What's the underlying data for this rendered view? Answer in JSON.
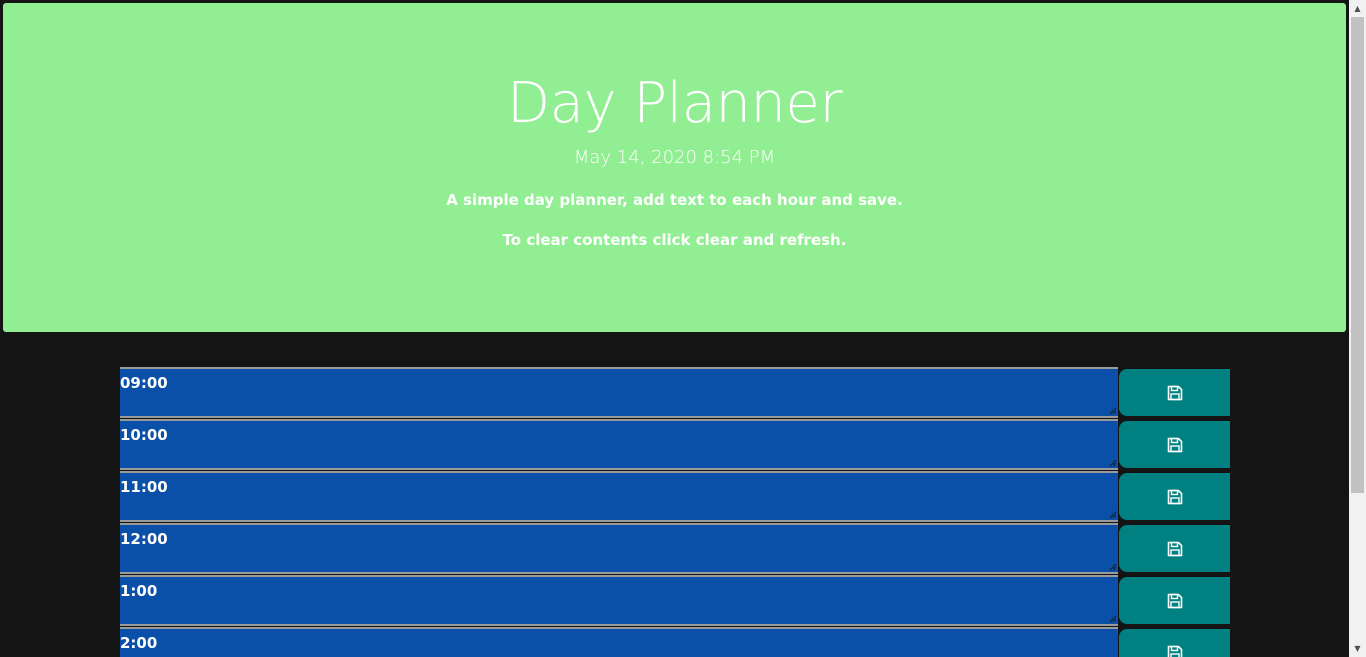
{
  "header": {
    "title": "Day Planner",
    "datetime": "May 14, 2020 8:54 PM",
    "description": "A simple day planner, add text to each hour and save.",
    "clear_note": "To clear contents click clear and refresh."
  },
  "hours": [
    {
      "label": "09:00",
      "text": ""
    },
    {
      "label": "10:00",
      "text": ""
    },
    {
      "label": "11:00",
      "text": ""
    },
    {
      "label": "12:00",
      "text": ""
    },
    {
      "label": "1:00",
      "text": ""
    },
    {
      "label": "2:00",
      "text": ""
    }
  ],
  "save_icon": "floppy-disk-icon",
  "colors": {
    "header_bg": "#92ee92",
    "page_bg": "#141414",
    "hour_block": "#0a4fa8",
    "save_button": "#008080"
  }
}
